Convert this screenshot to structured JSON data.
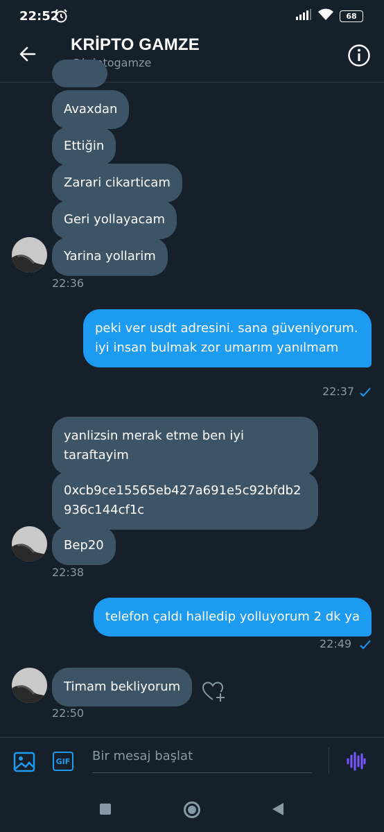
{
  "status_bar": {
    "time": "22:52",
    "battery": "68"
  },
  "header": {
    "title": "KRİPTO GAMZE",
    "handle": "@kriptogamze"
  },
  "messages": {
    "m1": "Avaxdan",
    "m2": "Ettiğin",
    "m3": "Zarari cikarticam",
    "m4": "Geri yollayacam",
    "m5": "Yarina yollarim",
    "t1": "22:36",
    "m6": "peki ver usdt adresini. sana güveniyorum. iyi insan bulmak zor umarım yanılmam",
    "t2": "22:37",
    "m7": "yanlizsin merak etme ben iyi taraftayim",
    "m8": "0xcb9ce15565eb427a691e5c92bfdb2936c144cf1c",
    "m9": "Bep20",
    "t3": "22:38",
    "m10": "telefon çaldı halledip yolluyorum 2 dk ya",
    "t4": "22:49",
    "m11": "Timam bekliyorum",
    "t5": "22:50"
  },
  "composer": {
    "gif_label": "GIF",
    "placeholder": "Bir mesaj başlat"
  },
  "icons": {
    "back": "arrow-left-icon",
    "info": "info-icon",
    "read_receipt": "check-icon",
    "like": "heart-plus-icon",
    "image": "image-icon",
    "gif": "gif-icon",
    "voice": "voice-wave-icon"
  },
  "colors": {
    "background": "#15202b",
    "incoming": "#3d5466",
    "outgoing": "#1d9bf0",
    "muted": "#8899a6",
    "voice": "#7856ff"
  }
}
